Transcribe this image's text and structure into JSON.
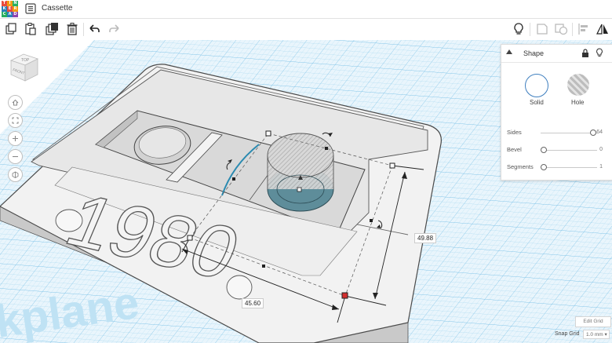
{
  "app": {
    "logo_letters": [
      "T",
      "I",
      "N",
      "K",
      "E",
      "R",
      "C",
      "A",
      "D"
    ],
    "logo_colors": [
      "#e84c3d",
      "#f39c12",
      "#27ae60",
      "#2980b9",
      "#e84c3d",
      "#f39c12",
      "#27ae60",
      "#2980b9",
      "#8e44ad"
    ],
    "title": "Cassette"
  },
  "toolbar": {
    "left_icons": [
      "copy-icon",
      "paste-icon",
      "duplicate-icon",
      "delete-icon",
      "undo-icon",
      "redo-icon"
    ],
    "right_icons": [
      "bulb-icon",
      "note-icon",
      "group-icon",
      "align-icon",
      "mirror-icon"
    ]
  },
  "scene": {
    "year_text": "1980",
    "workplane_text": "kplane",
    "dimension_height": "49.88",
    "dimension_width": "45.60",
    "viewcube_top": "TOP",
    "viewcube_front": "FRONT"
  },
  "nav": {
    "icons": [
      "home-icon",
      "fit-icon",
      "zoom-in-icon",
      "zoom-out-icon",
      "ortho-icon"
    ]
  },
  "panel": {
    "title": "Shape",
    "solid_label": "Solid",
    "hole_label": "Hole",
    "props": [
      {
        "label": "Sides",
        "value": "64",
        "fraction": 0.95
      },
      {
        "label": "Bevel",
        "value": "0",
        "fraction": 0.0
      },
      {
        "label": "Segments",
        "value": "1",
        "fraction": 0.0
      }
    ]
  },
  "grid": {
    "edit_label": "Edit Grid",
    "snap_label": "Snap Grid",
    "snap_value": "1.0 mm ▾"
  },
  "colors": {
    "grid_blue": "#7fc3e8",
    "selected_fill": "#5e8d9a",
    "handle_red": "#d32f2f",
    "accent": "#3f7fbf"
  }
}
